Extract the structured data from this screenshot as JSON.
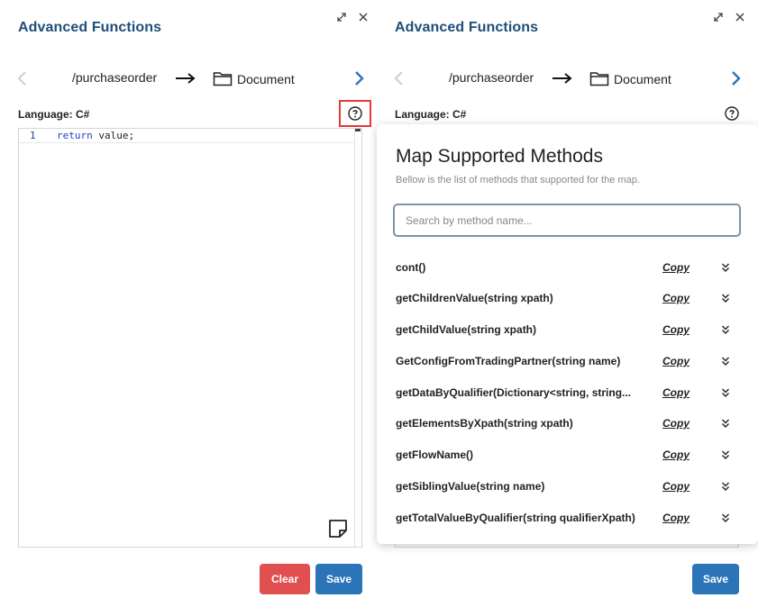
{
  "left": {
    "title": "Advanced Functions",
    "path": "/purchaseorder",
    "target": "Document",
    "language": "Language: C#",
    "code": {
      "line_number": "1",
      "keyword": "return",
      "rest": " value;"
    },
    "buttons": {
      "clear": "Clear",
      "save": "Save"
    }
  },
  "right": {
    "title": "Advanced Functions",
    "path": "/purchaseorder",
    "target": "Document",
    "language": "Language: C#",
    "save": "Save",
    "popup": {
      "title": "Map Supported Methods",
      "subtitle": "Bellow is the list of methods that supported for the map.",
      "search_placeholder": "Search by method name...",
      "copy_label": "Copy",
      "methods": [
        "cont()",
        "getChildrenValue(string xpath)",
        "getChildValue(string xpath)",
        "GetConfigFromTradingPartner(string name)",
        "getDataByQualifier(Dictionary<string, string...",
        "getElementsByXpath(string xpath)",
        "getFlowName()",
        "getSiblingValue(string name)",
        "getTotalValueByQualifier(string qualifierXpath)"
      ]
    }
  },
  "colors": {
    "title": "#1f4e79",
    "accent_blue": "#2b74b8",
    "danger": "#e05050",
    "highlight_box": "#e53935"
  },
  "icons": [
    "expand-icon",
    "close-icon",
    "chevron-left-icon",
    "arrow-right-icon",
    "folder-icon",
    "chevron-right-icon",
    "help-icon",
    "page-icon",
    "double-chevron-down-icon"
  ]
}
